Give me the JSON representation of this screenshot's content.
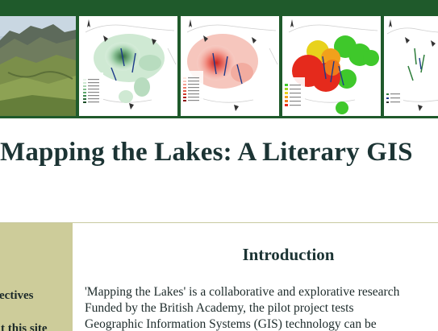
{
  "site": {
    "title": "Mapping the Lakes: A Literary GIS"
  },
  "banner": {
    "tiles": [
      {
        "name": "lake-district-photo",
        "kind": "photograph"
      },
      {
        "name": "density-map-green",
        "kind": "map",
        "legend_title": "Density"
      },
      {
        "name": "density-map-red",
        "kind": "map",
        "legend_title": "Density"
      },
      {
        "name": "percentage-map",
        "kind": "map",
        "legend_title": "% of locations"
      },
      {
        "name": "feature-map",
        "kind": "map",
        "legend_title": "Feature"
      }
    ]
  },
  "sidebar": {
    "items": [
      {
        "label": "Objectives"
      },
      {
        "label": "About this site"
      }
    ]
  },
  "intro": {
    "heading": "Introduction",
    "lines": [
      "'Mapping the Lakes' is a collaborative and explorative research",
      "Funded by the British Academy, the pilot project tests",
      "Geographic Information Systems (GIS) technology can be"
    ]
  },
  "colors": {
    "banner_border": "#1f5a2b",
    "sidebar_bg": "#cdcc9a",
    "title_text": "#1c3434"
  }
}
